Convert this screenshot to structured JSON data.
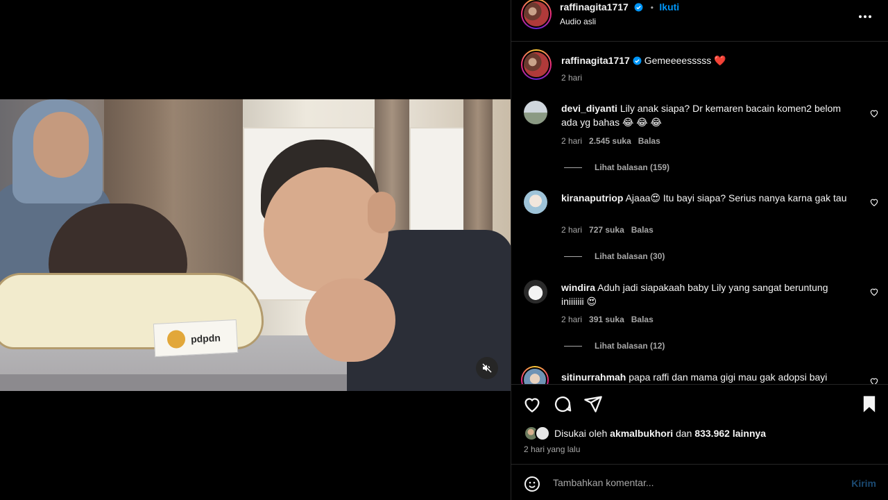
{
  "post": {
    "username": "raffinagita1717",
    "follow_label": "Ikuti",
    "separator": "•",
    "audio": "Audio asli"
  },
  "caption": {
    "username": "raffinagita1717",
    "text": "Gemeeeesssss",
    "emoji": "❤️",
    "time": "2 hari"
  },
  "video": {
    "pillow_brand": "pdpdn"
  },
  "comments": [
    {
      "username": "devi_diyanti",
      "text": "Lily anak siapa? Dr kemaren bacain komen2 belom ada yg bahas 😂 😂 😂",
      "time": "2 hari",
      "likes": "2.545 suka",
      "reply": "Balas",
      "view_replies": "Lihat balasan (159)"
    },
    {
      "username": "kiranaputriop",
      "text": "Ajaaa😍 Itu bayi siapa? Serius nanya karna gak tau",
      "time": "2 hari",
      "likes": "727 suka",
      "reply": "Balas",
      "view_replies": "Lihat balasan (30)"
    },
    {
      "username": "windira",
      "text": "Aduh jadi siapakaah baby Lily yang sangat beruntung iniiiiiii 😍",
      "time": "2 hari",
      "likes": "391 suka",
      "reply": "Balas",
      "view_replies": "Lihat balasan (12)"
    },
    {
      "username": "sitinurrahmah",
      "text": "papa raffi dan mama gigi mau gak adopsi bayi"
    }
  ],
  "likes": {
    "prefix": "Disukai oleh",
    "user": "akmalbukhori",
    "middle": "dan",
    "count": "833.962 lainnya"
  },
  "date": "2 hari yang lalu",
  "composer": {
    "placeholder": "Tambahkan komentar...",
    "send_label": "Kirim"
  },
  "colors": {
    "accent": "#0095f6",
    "heart": "#ff3040",
    "muted_text": "#a8a8a8",
    "border": "#262626"
  }
}
